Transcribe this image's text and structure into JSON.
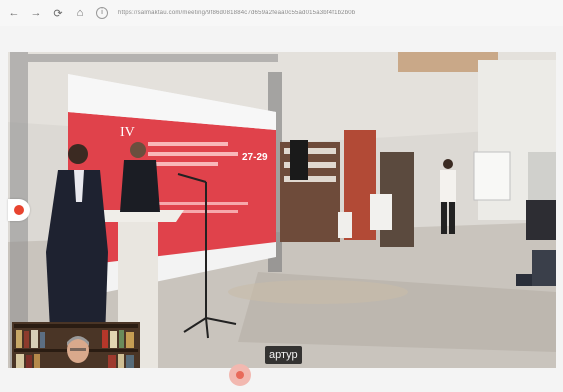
{
  "browser": {
    "back_icon": "back-arrow-icon",
    "forward_icon": "forward-arrow-icon",
    "reload_icon": "reload-icon",
    "home_icon": "home-icon",
    "url": "https://salmaktau.com/meeting/9f86d081884c7d659a2feaa0c55ad015a3bf4f1b2b0b"
  },
  "video": {
    "participant_name": "артур",
    "screen": {
      "roman_numeral": "IV",
      "dates": "27-29",
      "accent_color": "#e0424b"
    }
  },
  "controls": {
    "record_indicator_color": "#e8442f",
    "pin_color": "#e86a5a"
  }
}
